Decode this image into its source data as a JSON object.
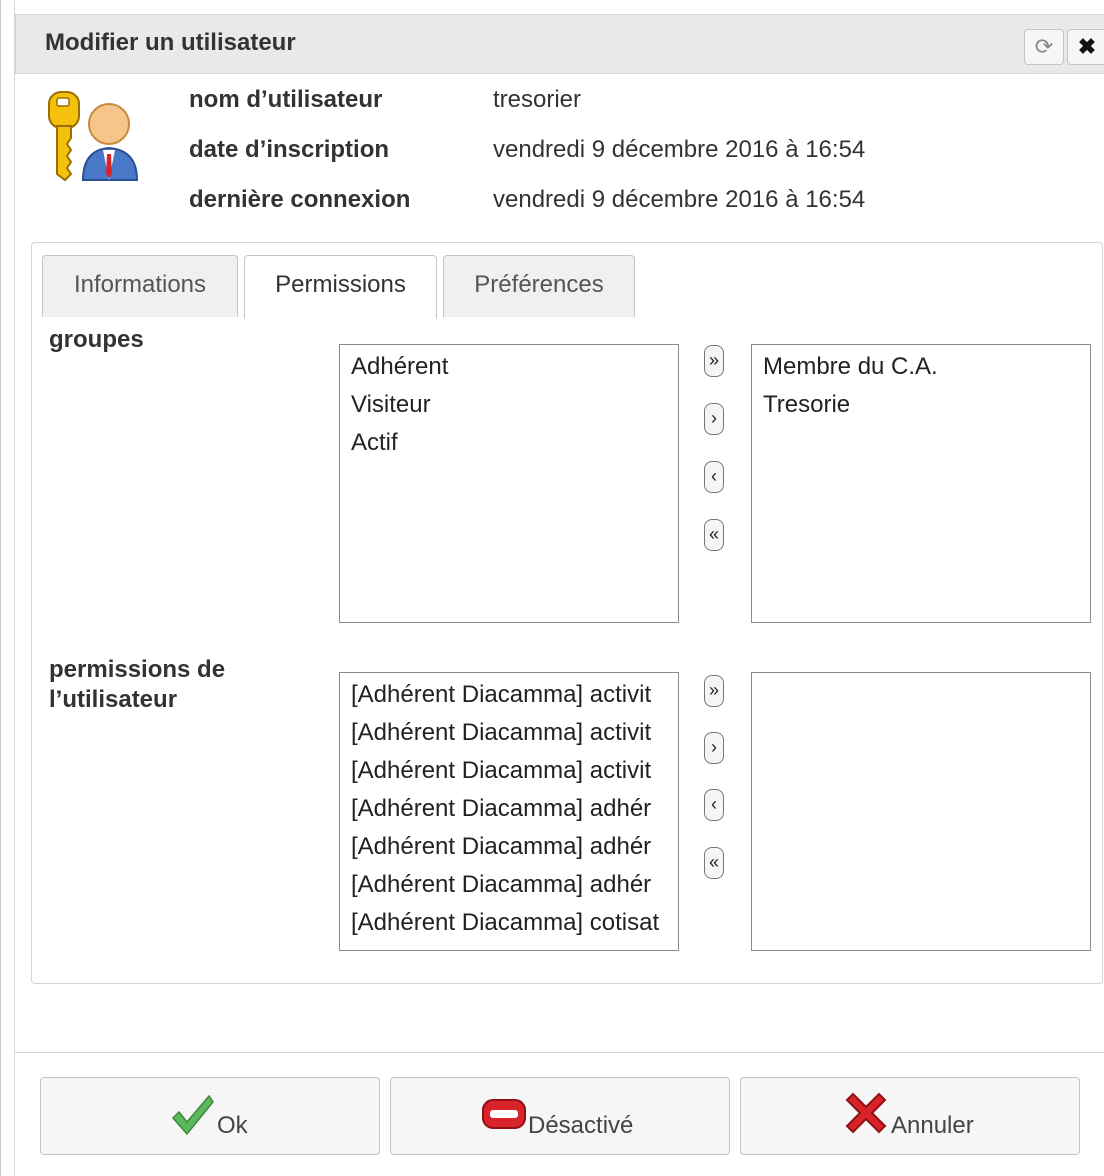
{
  "dialog": {
    "title": "Modifier un utilisateur"
  },
  "user_info": {
    "username_label": "nom d’utilisateur",
    "username_value": "tresorier",
    "signup_label": "date d’inscription",
    "signup_value": "vendredi 9 décembre 2016 à 16:54",
    "lastlogin_label": "dernière connexion",
    "lastlogin_value": "vendredi 9 décembre 2016 à 16:54"
  },
  "tabs": [
    {
      "label": "Informations",
      "active": false
    },
    {
      "label": "Permissions",
      "active": true
    },
    {
      "label": "Préférences",
      "active": false
    }
  ],
  "groups": {
    "label": "groupes",
    "available": [
      "Adhérent",
      "Visiteur",
      "Actif"
    ],
    "selected": [
      "Membre du C.A.",
      "Tresorie"
    ]
  },
  "permissions": {
    "label_line1": "permissions de",
    "label_line2": "l’utilisateur",
    "available": [
      "[Adhérent Diacamma] activit",
      "[Adhérent Diacamma] activit",
      "[Adhérent Diacamma] activit",
      "[Adhérent Diacamma] adhér",
      "[Adhérent Diacamma] adhér",
      "[Adhérent Diacamma] adhér",
      "[Adhérent Diacamma] cotisat"
    ],
    "selected": []
  },
  "transfer_buttons": {
    "add_all": "»",
    "add_one": "›",
    "remove_one": "‹",
    "remove_all": "«"
  },
  "titlebar_icons": {
    "refresh": "refresh-icon",
    "close": "close-icon"
  },
  "buttons": {
    "ok": "Ok",
    "deactivated": "Désactivé",
    "cancel": "Annuler"
  },
  "colors": {
    "titlebar": "#e9e9e9",
    "ok_check": "#5cb85c",
    "deactivate_red": "#d9232a",
    "cancel_red": "#d9232a"
  }
}
